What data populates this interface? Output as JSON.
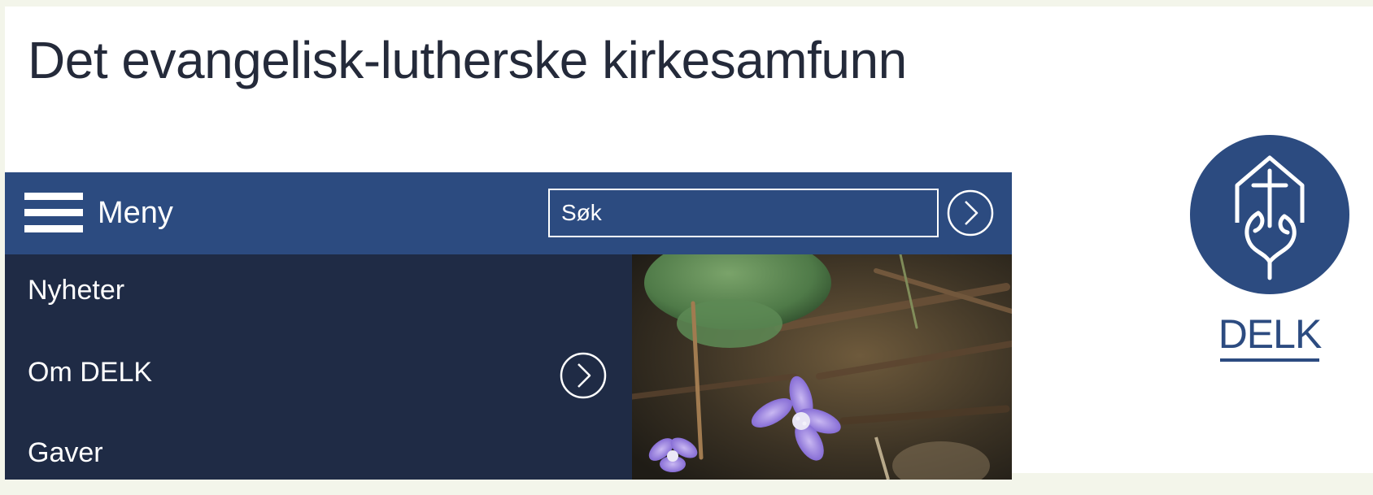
{
  "site": {
    "title": "Det evangelisk-lutherske kirkesamfunn"
  },
  "navbar": {
    "menu_label": "Meny",
    "search_placeholder": "Søk"
  },
  "menu": {
    "items": [
      {
        "label": "Nyheter",
        "expandable": false
      },
      {
        "label": "Om DELK",
        "expandable": true
      },
      {
        "label": "Gaver",
        "expandable": false
      }
    ]
  },
  "logo": {
    "text": "DELK"
  },
  "colors": {
    "navbar": "#2c4b80",
    "dropdown": "#1f2b45",
    "title": "#242a3a",
    "page_bg": "#f3f5ea"
  },
  "icons": {
    "menu": "hamburger-icon",
    "search_go": "chevron-right-circle-icon",
    "expand": "chevron-right-circle-icon",
    "logo": "church-hands-cross-logo"
  }
}
